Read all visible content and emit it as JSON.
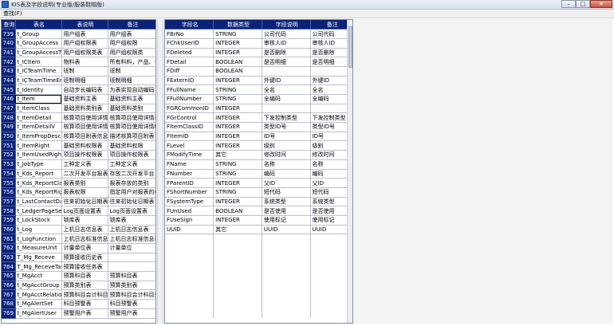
{
  "window": {
    "title": "KIS表及字段说明(专业版/服装鞋帽版)",
    "minimize": "–",
    "maximize": "□",
    "close": "✕"
  },
  "menu": {
    "query": "查找(F)"
  },
  "left_table": {
    "headers": [
      "查询",
      "表名",
      "表说明",
      "备注"
    ],
    "rows": [
      [
        "739",
        "t_Group",
        "用户组表",
        "用户组表"
      ],
      [
        "740",
        "t_GroupAccess",
        "用户组权限表",
        "用户组权限"
      ],
      [
        "741",
        "t_GroupAccessType",
        "用户组权限类表",
        "用户组权限类"
      ],
      [
        "742",
        "t_ICItem",
        "物料表",
        "所有料料，产品、书"
      ],
      [
        "743",
        "t_ICTeamTime",
        "班制",
        "班制"
      ],
      [
        "744",
        "t_ICTeamTimeEntry",
        "班制明细",
        "班制明细"
      ],
      [
        "745",
        "t_Identity",
        "自动步长编码表",
        "为表实现自动编码"
      ],
      [
        "746",
        "t_Item",
        "基础资料主表",
        "基础资料主表"
      ],
      [
        "747",
        "t_ItemClass",
        "基础资料类别表",
        "基础资料类别"
      ],
      [
        "748",
        "t_ItemDetail",
        "核算项目使用详情表",
        "核算项目使用详情表"
      ],
      [
        "749",
        "t_ItemDetailV",
        "核算项目使用详情纵表",
        "核算项目使用详情纵表"
      ],
      [
        "750",
        "t_ItemPropDesc",
        "核算项目附表信息描述",
        "描述核算项目附表"
      ],
      [
        "751",
        "t_ItemRight",
        "基础资料权限表",
        "基础资料权限"
      ],
      [
        "752",
        "t_ItemUsedRight",
        "项目操作权限表",
        "项目操作权限表"
      ],
      [
        "753",
        "t_JobType",
        "工种定义表",
        "工种定义表"
      ],
      [
        "754",
        "t_Kds_Report",
        "二次开发平台报表",
        "存放二次开发平台"
      ],
      [
        "755",
        "t_Kds_ReportClass",
        "报表类别",
        "报表存放的类别"
      ],
      [
        "756",
        "t_Kds_ReportRight",
        "报表权限",
        "指定用户对报表的权"
      ],
      [
        "757",
        "t_LastContactDate",
        "往来初始化日期表",
        "往来初始化日期表"
      ],
      [
        "758",
        "t_LedgerPageSetup",
        "Log页面设置表",
        "Log页面设置表"
      ],
      [
        "759",
        "t_LockStock",
        "锁库表",
        "锁库表"
      ],
      [
        "760",
        "t_Log",
        "上机日志信息表",
        "上机日志信息表"
      ],
      [
        "761",
        "t_LogFunction",
        "上机日志标准信息表",
        "上机日志标准信息表"
      ],
      [
        "762",
        "t_MeasureUnit",
        "计量单位表",
        "计量单位"
      ],
      [
        "763",
        "T_Mg_Receve",
        "预算接收历史表",
        ""
      ],
      [
        "764",
        "T_Mg_ReceveTask",
        "预算接收任务表",
        ""
      ],
      [
        "765",
        "t_MgAcct",
        "预算科目表",
        "预算科目表"
      ],
      [
        "766",
        "t_MgAcctGroup",
        "预算类别表",
        "预算类别表"
      ],
      [
        "767",
        "t_MgAcctRelation",
        "预算科目会计科目对应表",
        "预算科目会计科目对"
      ],
      [
        "768",
        "t_MgAlertSet",
        "科目预警表",
        "科目预警表"
      ],
      [
        "769",
        "t_MgAlertUser",
        "预警用户表",
        "预警用户表"
      ]
    ]
  },
  "right_table": {
    "headers": [
      "字段名",
      "数据类型",
      "字段说明",
      "备注"
    ],
    "rows": [
      [
        "FBrNo",
        "STRING",
        "公司代码",
        "公司代码"
      ],
      [
        "FChkUserID",
        "INTEGER",
        "审核人ID",
        "审核人ID"
      ],
      [
        "FDeleted",
        "INTEGER",
        "是否删除",
        "是否删除"
      ],
      [
        "FDetail",
        "BOOLEAN",
        "是否明细",
        "是否明细"
      ],
      [
        "FDiff",
        "BOOLEAN",
        "",
        ""
      ],
      [
        "FExternID",
        "INTEGER",
        "外键ID",
        "外键ID"
      ],
      [
        "FFullName",
        "STRING",
        "全名",
        "全名"
      ],
      [
        "FFullNumber",
        "STRING",
        "全编码",
        "全编码"
      ],
      [
        "FGRCommonID",
        "INTEGER",
        "",
        ""
      ],
      [
        "FGrControl",
        "INTEGER",
        "下发控制类型",
        "下发控制类型"
      ],
      [
        "FItemClassID",
        "INTEGER",
        "类型ID号",
        "类型ID号"
      ],
      [
        "FItemID",
        "INTEGER",
        "ID号",
        "ID号"
      ],
      [
        "FLevel",
        "INTEGER",
        "级别",
        "级别"
      ],
      [
        "FModifyTime",
        "其它",
        "修改时间",
        "修改时间"
      ],
      [
        "FName",
        "STRING",
        "名称",
        "名称"
      ],
      [
        "FNumber",
        "STRING",
        "编码",
        "编码"
      ],
      [
        "FParentID",
        "INTEGER",
        "父ID",
        "父ID"
      ],
      [
        "FShortNumber",
        "STRING",
        "短代码",
        "短代码"
      ],
      [
        "FSystemType",
        "INTEGER",
        "系统类型",
        "系统类型"
      ],
      [
        "FUnUsed",
        "BOOLEAN",
        "是否使用",
        "是否使用"
      ],
      [
        "FUseSign",
        "INTEGER",
        "使用标记",
        "使用标记"
      ],
      [
        "UUID",
        "其它",
        "UUID",
        "UUID"
      ]
    ],
    "blank_rows": 9
  },
  "selected_row": "746",
  "colors": {
    "header_bg": "#0a237a",
    "header_fg": "#ffffff",
    "grid_line": "#b9c0cc"
  }
}
